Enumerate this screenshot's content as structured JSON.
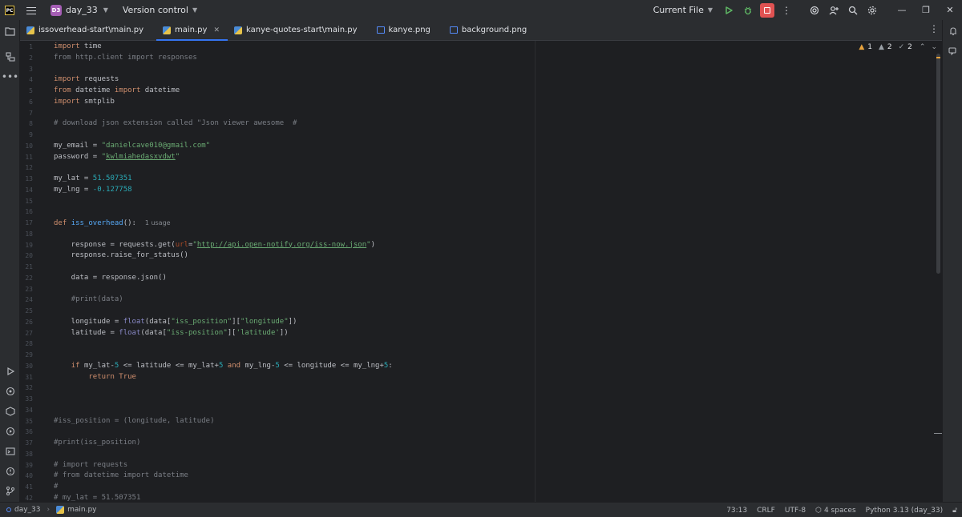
{
  "titlebar": {
    "project_badge": "D3",
    "project_name": "day_33",
    "vcs_label": "Version control",
    "run_config": "Current File"
  },
  "tabs": [
    {
      "label": "issoverhead-start\\main.py",
      "type": "py",
      "active": false
    },
    {
      "label": "main.py",
      "type": "py",
      "active": true
    },
    {
      "label": "kanye-quotes-start\\main.py",
      "type": "py",
      "active": false
    },
    {
      "label": "kanye.png",
      "type": "png",
      "active": false
    },
    {
      "label": "background.png",
      "type": "png",
      "active": false
    }
  ],
  "inspections": {
    "warnings": "1",
    "weak_warnings": "2",
    "typos": "2"
  },
  "editor": {
    "lines": [
      {
        "n": "1",
        "html": "<span class=\"kw\">import</span> time"
      },
      {
        "n": "2",
        "html": "<span class=\"cmt\">from http.client import responses</span>"
      },
      {
        "n": "3",
        "html": ""
      },
      {
        "n": "4",
        "html": "<span class=\"kw\">import</span> requests"
      },
      {
        "n": "5",
        "html": "<span class=\"kw\">from</span> datetime <span class=\"kw\">import</span> datetime"
      },
      {
        "n": "6",
        "html": "<span class=\"kw\">import</span> smtplib"
      },
      {
        "n": "7",
        "html": ""
      },
      {
        "n": "8",
        "html": "<span class=\"cmt\"># download json extension called \"Json viewer awesome  #</span>"
      },
      {
        "n": "9",
        "html": ""
      },
      {
        "n": "10",
        "html": "my_email = <span class=\"str\">\"danielcave010@gmail.com\"</span>"
      },
      {
        "n": "11",
        "html": "password = <span class=\"str\">\"<span class=\"link\">kwlmiahedasxvdwt</span>\"</span>"
      },
      {
        "n": "12",
        "html": ""
      },
      {
        "n": "13",
        "html": "my_lat = <span class=\"num\">51.507351</span>"
      },
      {
        "n": "14",
        "html": "my_lng = <span class=\"num\">-0.127758</span>"
      },
      {
        "n": "15",
        "html": ""
      },
      {
        "n": "16",
        "html": ""
      },
      {
        "n": "17",
        "html": "<span class=\"kw\">def</span> <span class=\"fn\">iss_overhead</span>():  <span class=\"hint\">1 usage</span>"
      },
      {
        "n": "18",
        "html": ""
      },
      {
        "n": "19",
        "html": "    response = requests.get(<span class=\"param\">url</span>=<span class=\"str\">\"<span class=\"link\">http://api.open-notify.org/iss-now.json</span>\"</span>)"
      },
      {
        "n": "20",
        "html": "    response.raise_for_status()"
      },
      {
        "n": "21",
        "html": ""
      },
      {
        "n": "22",
        "html": "    data = response.json()"
      },
      {
        "n": "23",
        "html": ""
      },
      {
        "n": "24",
        "html": "    <span class=\"cmt\">#print(data)</span>"
      },
      {
        "n": "25",
        "html": ""
      },
      {
        "n": "26",
        "html": "    longitude = <span class=\"builtin\">float</span>(data[<span class=\"str\">\"iss_position\"</span>][<span class=\"str\">\"longitude\"</span>])"
      },
      {
        "n": "27",
        "html": "    latitude = <span class=\"builtin\">float</span>(data[<span class=\"str\">\"iss-position\"</span>][<span class=\"str\">'latitude'</span>])"
      },
      {
        "n": "28",
        "html": ""
      },
      {
        "n": "29",
        "html": ""
      },
      {
        "n": "30",
        "html": "    <span class=\"kw\">if</span> my_lat-<span class=\"num\">5</span> &lt;= latitude &lt;= my_lat+<span class=\"num\">5</span> <span class=\"kw\">and</span> my_lng-<span class=\"num\">5</span> &lt;= longitude &lt;= my_lng+<span class=\"num\">5</span>:"
      },
      {
        "n": "31",
        "html": "        <span class=\"kw\">return</span> <span class=\"kw\">True</span>"
      },
      {
        "n": "32",
        "html": ""
      },
      {
        "n": "33",
        "html": ""
      },
      {
        "n": "34",
        "html": ""
      },
      {
        "n": "35",
        "html": "<span class=\"cmt\">#iss_position = (longitude, latitude)</span>"
      },
      {
        "n": "36",
        "html": ""
      },
      {
        "n": "37",
        "html": "<span class=\"cmt\">#print(iss_position)</span>"
      },
      {
        "n": "38",
        "html": ""
      },
      {
        "n": "39",
        "html": "<span class=\"cmt\"># import requests</span>"
      },
      {
        "n": "40",
        "html": "<span class=\"cmt\"># from datetime import datetime</span>"
      },
      {
        "n": "41",
        "html": "<span class=\"cmt\">#</span>"
      },
      {
        "n": "42",
        "html": "<span class=\"cmt\"># my_lat = 51.507351</span>"
      }
    ]
  },
  "statusbar": {
    "project": "day_33",
    "file": "main.py",
    "position": "73:13",
    "line_ending": "CRLF",
    "encoding": "UTF-8",
    "indent": "4 spaces",
    "interpreter": "Python 3.13 (day_33)"
  }
}
